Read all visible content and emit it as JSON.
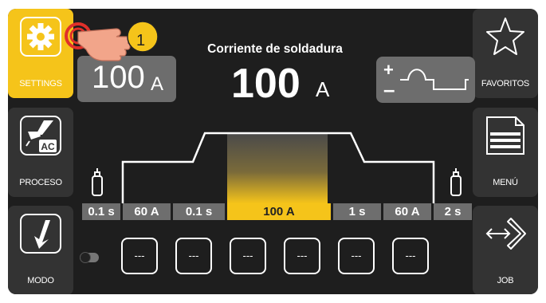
{
  "left_menu": [
    {
      "label": "SETTINGS",
      "icon": "gear-icon",
      "active": true
    },
    {
      "label": "PROCESO",
      "icon": "torch-ac-icon",
      "badge": "AC",
      "active": false
    },
    {
      "label": "MODO",
      "icon": "trigger-mode-icon",
      "active": false
    }
  ],
  "right_menu": [
    {
      "label": "FAVORITOS",
      "icon": "star-icon"
    },
    {
      "label": "MENÚ",
      "icon": "menu-document-icon"
    },
    {
      "label": "JOB",
      "icon": "job-arrows-icon"
    }
  ],
  "parameter": {
    "title": "Corriente de soldadura",
    "value": "100",
    "unit": "A"
  },
  "set_value": {
    "value": "100",
    "unit": "A"
  },
  "waveform": {
    "plus": "+",
    "minus": "–",
    "icon": "ac-wave-icon"
  },
  "callout": {
    "number": "1"
  },
  "sequence": [
    {
      "label": "0.1 s",
      "highlight": false
    },
    {
      "label": "60 A",
      "highlight": false
    },
    {
      "label": "0.1 s",
      "highlight": false
    },
    {
      "label": "100 A",
      "highlight": true
    },
    {
      "label": "1 s",
      "highlight": false
    },
    {
      "label": "60 A",
      "highlight": false
    },
    {
      "label": "2 s",
      "highlight": false
    }
  ],
  "jobs": [
    "---",
    "---",
    "---",
    "---",
    "---",
    "---"
  ],
  "colors": {
    "accent": "#f5c41a",
    "background": "#1e1e1e",
    "button": "#333333",
    "callout_red": "#e0302a"
  }
}
